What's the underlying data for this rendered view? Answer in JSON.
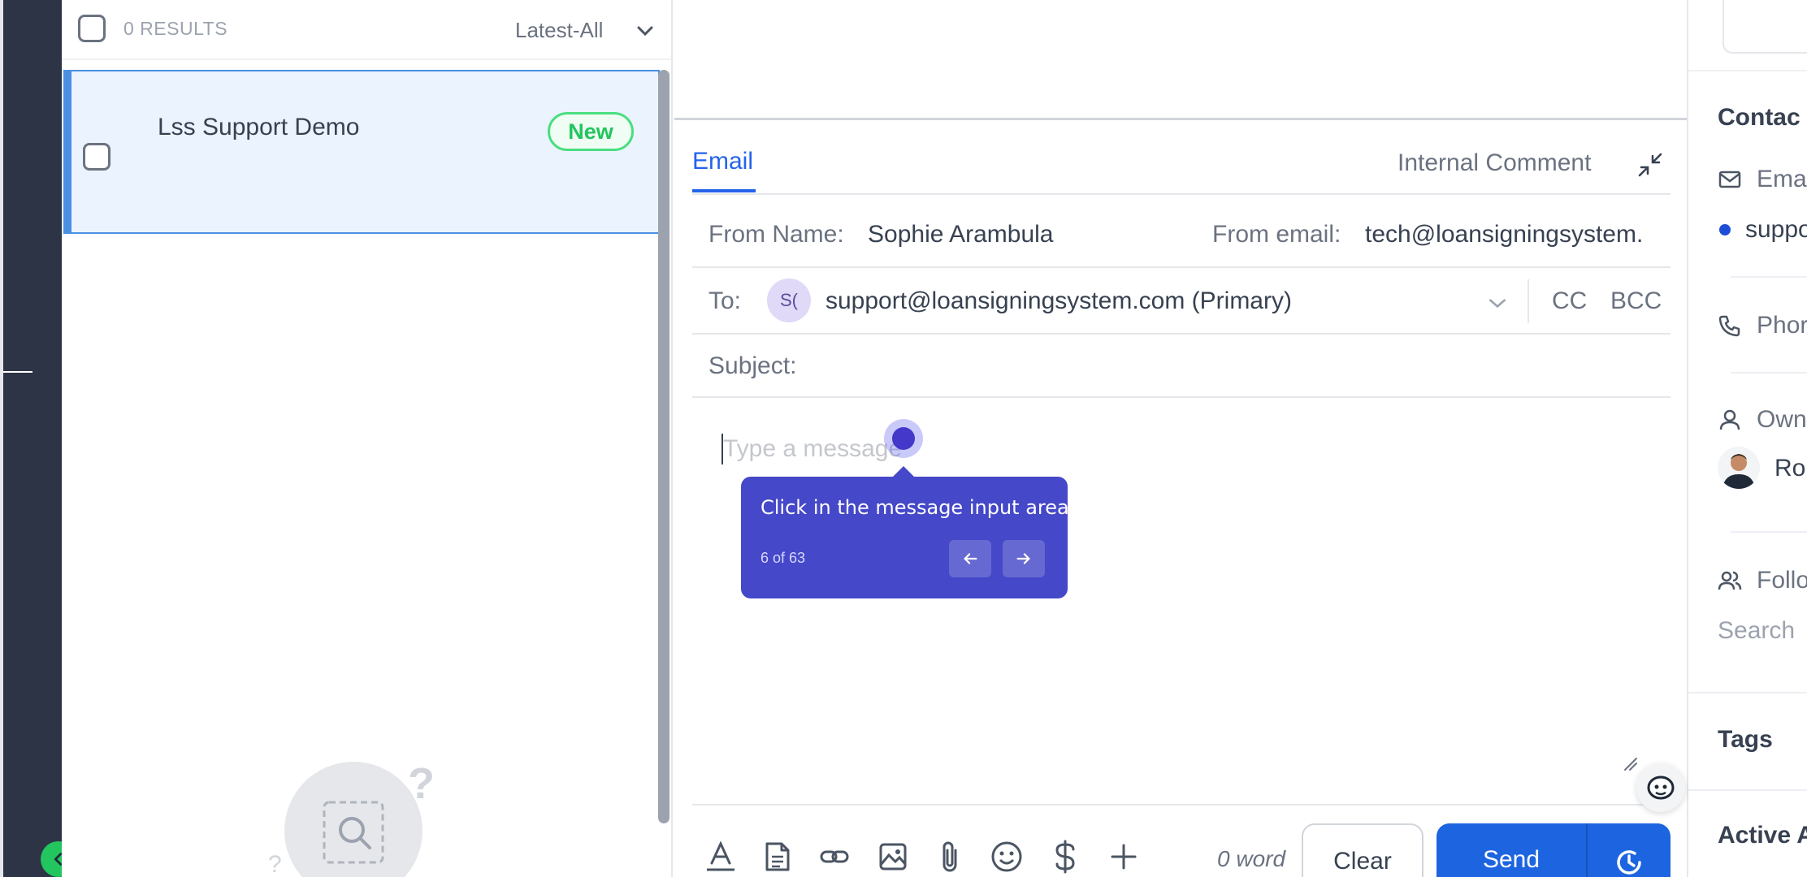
{
  "list": {
    "results_label": "0 RESULTS",
    "sort_label": "Latest-All",
    "conversations": [
      {
        "name": "Lss Support Demo",
        "badge": "New"
      }
    ]
  },
  "compose": {
    "tabs": {
      "email": "Email",
      "internal": "Internal Comment"
    },
    "from_name_label": "From Name:",
    "from_name_value": "Sophie Arambula",
    "from_email_label": "From email:",
    "from_email_value": "tech@loansigningsystem.",
    "to_label": "To:",
    "to_avatar_initials": "S(",
    "to_value": "support@loansigningsystem.com (Primary)",
    "cc_label": "CC",
    "bcc_label": "BCC",
    "subject_label": "Subject:",
    "subject_value": "",
    "message_placeholder": "Type a message",
    "word_count": "0 word",
    "clear_label": "Clear",
    "send_label": "Send"
  },
  "guide": {
    "text": "Click in the message input area.",
    "progress": "6 of 63",
    "color": "#4548c8"
  },
  "details": {
    "contact_head": "Contac",
    "email_label": "Ema",
    "email_value": "suppo",
    "phone_label": "Phor",
    "owner_label": "Own",
    "owner_name": "Ro",
    "followers_label": "Follo",
    "followers_search": "Search",
    "tags_head": "Tags",
    "active_head": "Active A"
  },
  "colors": {
    "accent": "#2563eb",
    "send": "#1d65e0",
    "new_badge": "#22c55e",
    "rail": "#2d3446"
  }
}
